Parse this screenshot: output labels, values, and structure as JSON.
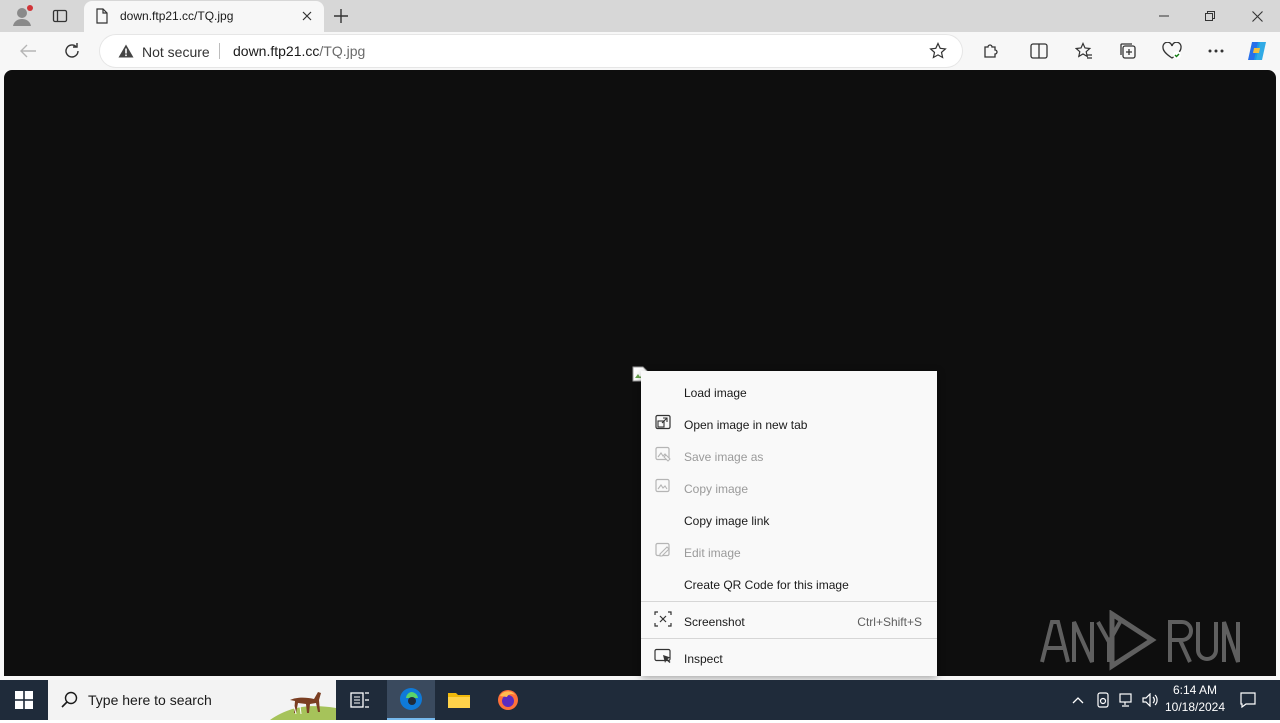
{
  "browser": {
    "tab_title": "down.ftp21.cc/TQ.jpg",
    "security_label": "Not secure",
    "url_host": "down.ftp21.cc",
    "url_path": "/TQ.jpg"
  },
  "context_menu": {
    "items": [
      {
        "label": "Load image",
        "enabled": true
      },
      {
        "label": "Open image in new tab",
        "enabled": true,
        "icon": "open-in-new-tab-icon"
      },
      {
        "label": "Save image as",
        "enabled": false,
        "icon": "save-image-icon"
      },
      {
        "label": "Copy image",
        "enabled": false,
        "icon": "copy-image-icon"
      },
      {
        "label": "Copy image link",
        "enabled": true
      },
      {
        "label": "Edit image",
        "enabled": false,
        "icon": "edit-image-icon"
      },
      {
        "label": "Create QR Code for this image",
        "enabled": true
      },
      {
        "label": "Screenshot",
        "enabled": true,
        "shortcut": "Ctrl+Shift+S",
        "icon": "screenshot-icon"
      },
      {
        "label": "Inspect",
        "enabled": true,
        "icon": "inspect-icon"
      }
    ]
  },
  "watermark": {
    "text": "ANY RUN"
  },
  "taskbar": {
    "search_placeholder": "Type here to search",
    "time": "6:14 AM",
    "date": "10/18/2024"
  },
  "colors": {
    "page_background": "#0e0e0e",
    "taskbar": "#1f2b3a",
    "edge_accent": "#0f7ad8"
  }
}
